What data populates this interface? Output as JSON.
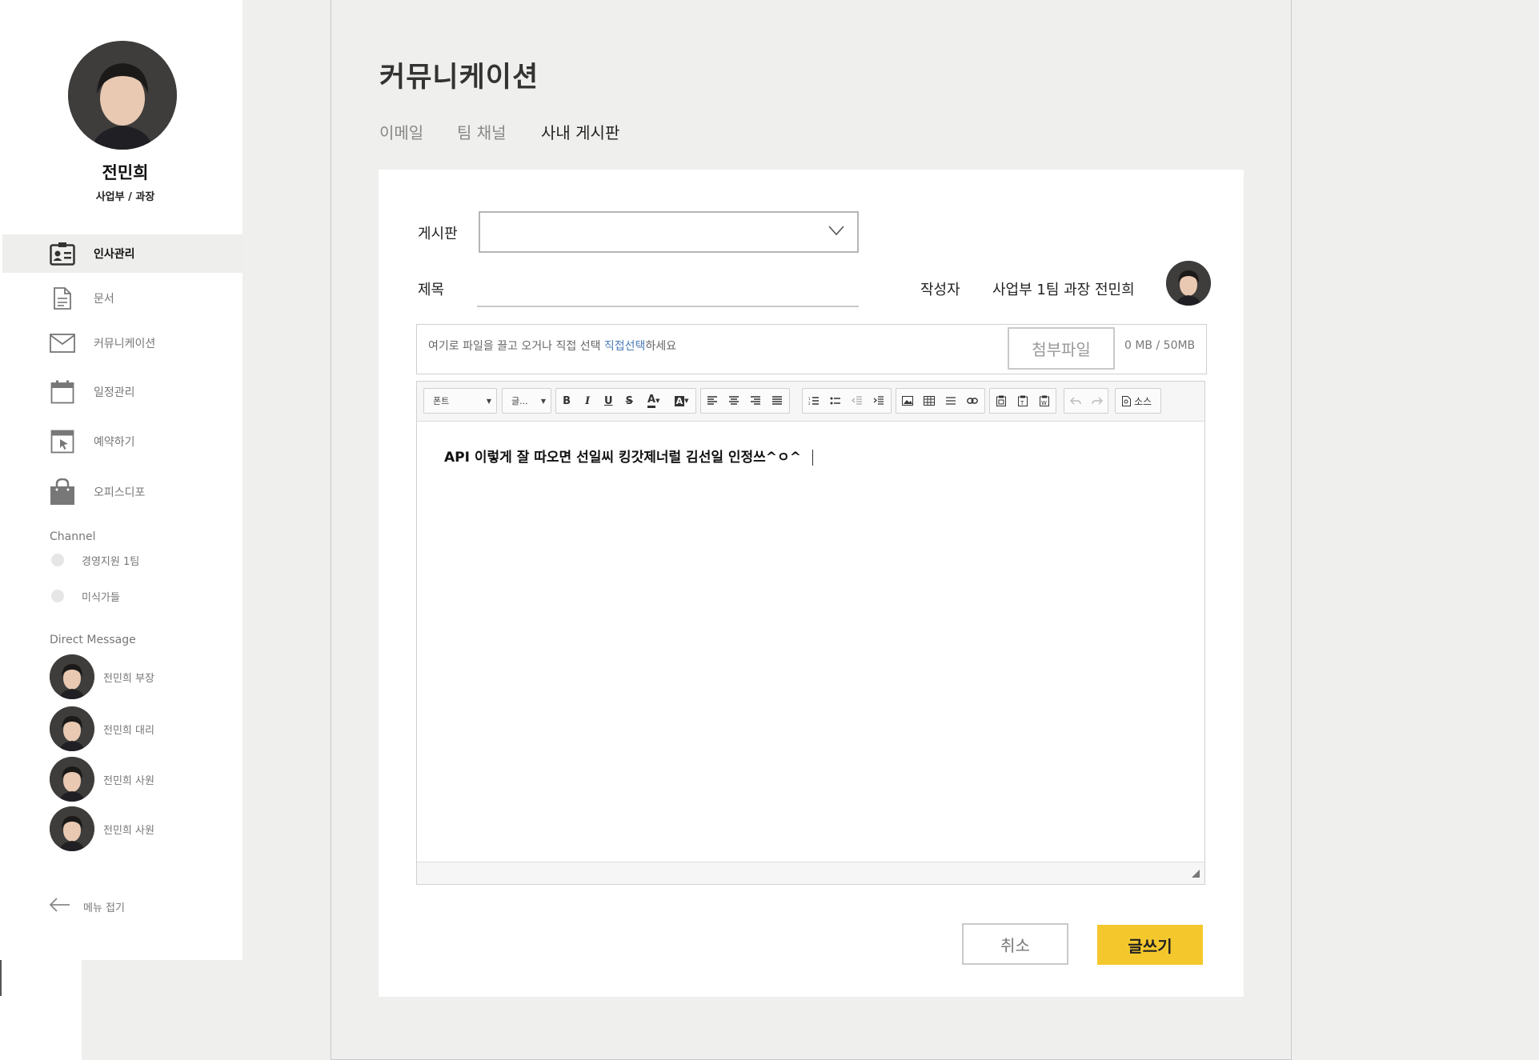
{
  "profile": {
    "name": "전민희",
    "dept": "사업부 / 과장"
  },
  "nav": {
    "items": [
      {
        "label": "인사관리",
        "icon": "id-card-icon",
        "active": true
      },
      {
        "label": "문서",
        "icon": "document-icon"
      },
      {
        "label": "커뮤니케이션",
        "icon": "mail-icon"
      },
      {
        "label": "일정관리",
        "icon": "calendar-icon"
      },
      {
        "label": "예약하기",
        "icon": "booking-icon"
      },
      {
        "label": "오피스디포",
        "icon": "shopping-bag-icon"
      }
    ]
  },
  "channel": {
    "title": "Channel",
    "items": [
      {
        "label": "경영지원 1팀"
      },
      {
        "label": "미식가들"
      }
    ]
  },
  "dm": {
    "title": "Direct Message",
    "items": [
      {
        "label": "전민희 부장"
      },
      {
        "label": "전민희 대리"
      },
      {
        "label": "전민희 사원"
      },
      {
        "label": "전민희 사원"
      }
    ]
  },
  "collapse_label": "메뉴 접기",
  "page": {
    "title": "커뮤니케이션"
  },
  "tabs": [
    {
      "label": "이메일"
    },
    {
      "label": "팀 채널"
    },
    {
      "label": "사내 게시판",
      "active": true
    }
  ],
  "form": {
    "board_label": "게시판",
    "board_value": "",
    "title_label": "제목",
    "title_value": "",
    "writer_label": "작성자",
    "writer_value": "사업부 1팀 과장 전민희"
  },
  "upload": {
    "text": "여기로 파일을 끌고 오거나 직접 선택 ",
    "link": "직접선택",
    "suffix": "하세요",
    "button": "첨부파일",
    "size": "0 MB / 50MB"
  },
  "toolbar": {
    "font": "폰트",
    "size": "글...",
    "source": "소스"
  },
  "editor": {
    "content": "API 이렇게 잘 따오면 선일씨 킹갓제너럴 김선일 인정쓰^ㅇ^"
  },
  "buttons": {
    "cancel": "취소",
    "submit": "글쓰기"
  },
  "colors": {
    "accent": "#f4c82d",
    "background": "#efefed",
    "active_nav": "#eeeeec",
    "link": "#4a7bb7"
  }
}
